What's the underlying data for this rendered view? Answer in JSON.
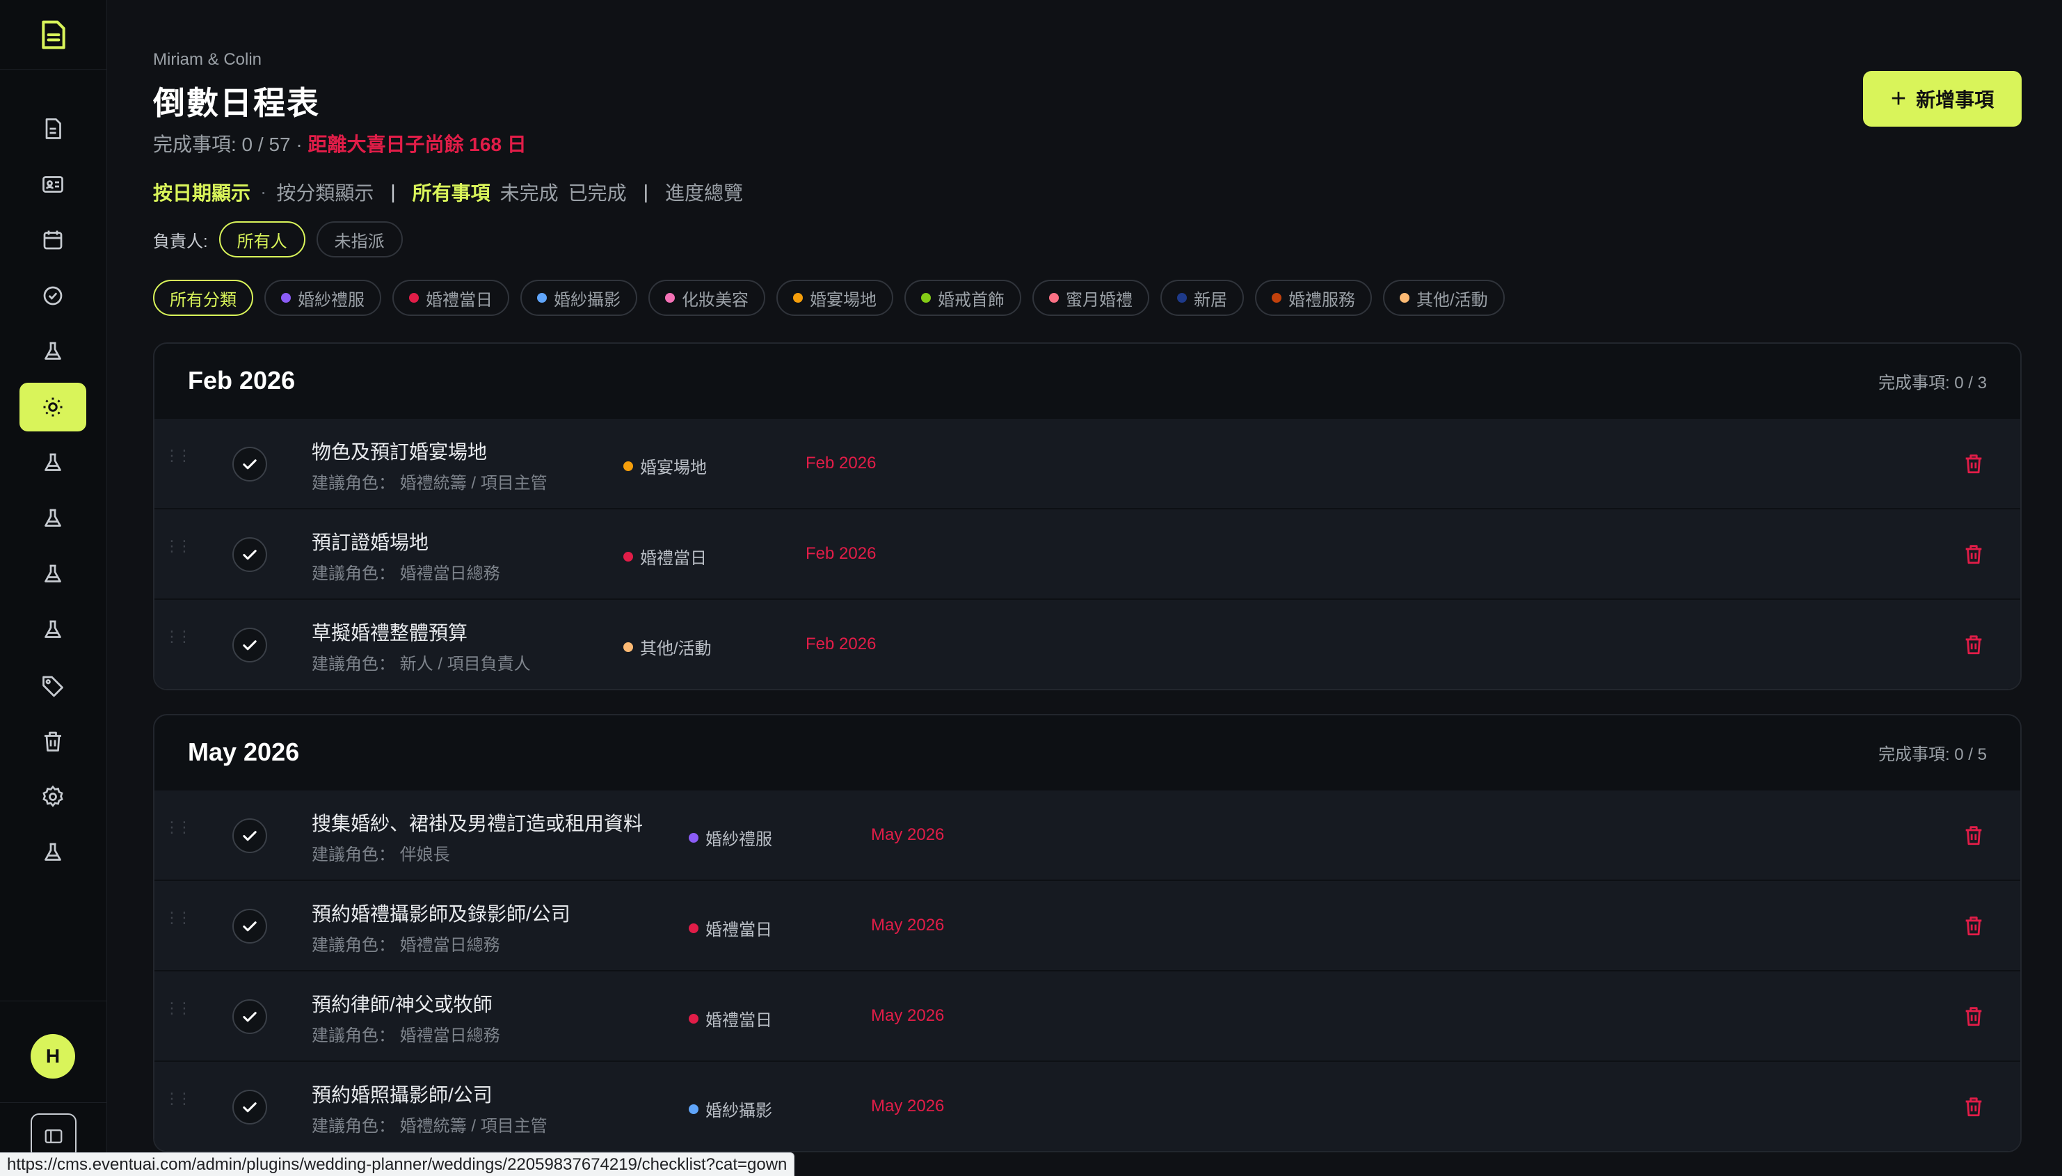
{
  "header": {
    "couple": "Miriam & Colin",
    "title": "倒數日程表",
    "progress_label": "完成事項: 0 / 57",
    "progress_sep": " · ",
    "countdown": "距離大喜日子尚餘 168 日",
    "add_button": "新增事項"
  },
  "view_bar": {
    "by_date": "按日期顯示",
    "dot": "·",
    "by_category": "按分類顯示",
    "sep1": "|",
    "all_items": "所有事項",
    "incomplete": "未完成",
    "completed": "已完成",
    "sep2": "|",
    "overview": "進度總覽"
  },
  "owner": {
    "label": "負責人:",
    "all": "所有人",
    "unassigned": "未指派"
  },
  "categories": [
    {
      "label": "所有分類",
      "color": null
    },
    {
      "label": "婚紗禮服",
      "color": "#8b5cf6"
    },
    {
      "label": "婚禮當日",
      "color": "#e11d48"
    },
    {
      "label": "婚紗攝影",
      "color": "#60a5fa"
    },
    {
      "label": "化妝美容",
      "color": "#f472b6"
    },
    {
      "label": "婚宴場地",
      "color": "#f59e0b"
    },
    {
      "label": "婚戒首飾",
      "color": "#84cc16"
    },
    {
      "label": "蜜月婚禮",
      "color": "#fb7185"
    },
    {
      "label": "新居",
      "color": "#1e3a8a"
    },
    {
      "label": "婚禮服務",
      "color": "#c2410c"
    },
    {
      "label": "其他/活動",
      "color": "#fdba74"
    }
  ],
  "groups": [
    {
      "title": "Feb 2026",
      "count": "完成事項: 0 / 3",
      "items": [
        {
          "title": "物色及預訂婚宴場地",
          "role": "建議角色： 婚禮統籌 / 項目主管",
          "category": "婚宴場地",
          "cat_color": "#f59e0b",
          "date": "Feb 2026"
        },
        {
          "title": "預訂證婚場地",
          "role": "建議角色： 婚禮當日總務",
          "category": "婚禮當日",
          "cat_color": "#e11d48",
          "date": "Feb 2026"
        },
        {
          "title": "草擬婚禮整體預算",
          "role": "建議角色： 新人 / 項目負責人",
          "category": "其他/活動",
          "cat_color": "#fdba74",
          "date": "Feb 2026"
        }
      ]
    },
    {
      "title": "May 2026",
      "count": "完成事項: 0 / 5",
      "items": [
        {
          "title": "搜集婚紗、裙褂及男禮訂造或租用資料",
          "role": "建議角色： 伴娘長",
          "category": "婚紗禮服",
          "cat_color": "#8b5cf6",
          "date": "May 2026"
        },
        {
          "title": "預約婚禮攝影師及錄影師/公司",
          "role": "建議角色： 婚禮當日總務",
          "category": "婚禮當日",
          "cat_color": "#e11d48",
          "date": "May 2026"
        },
        {
          "title": "預約律師/神父或牧師",
          "role": "建議角色： 婚禮當日總務",
          "category": "婚禮當日",
          "cat_color": "#e11d48",
          "date": "May 2026"
        },
        {
          "title": "預約婚照攝影師/公司",
          "role": "建議角色： 婚禮統籌 / 項目主管",
          "category": "婚紗攝影",
          "cat_color": "#60a5fa",
          "date": "May 2026"
        }
      ]
    }
  ],
  "user": {
    "initial": "H"
  },
  "status_bar": {
    "url": "https://cms.eventuai.com/admin/plugins/wedding-planner/weddings/22059837674219/checklist?cat=gown"
  },
  "colors": {
    "accent": "#d9f45a",
    "danger": "#e11d48",
    "bg": "#0f1115"
  }
}
